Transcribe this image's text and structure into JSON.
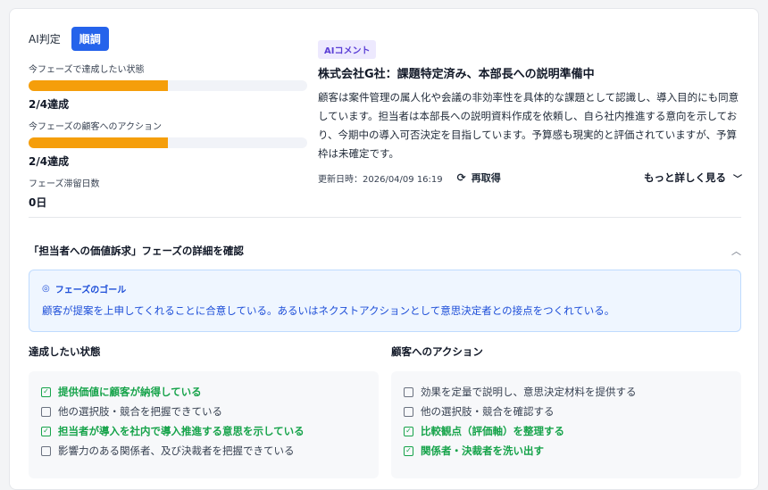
{
  "ai_judgement": {
    "label": "AI判定",
    "badge": "順調",
    "badge_color": "#2563eb"
  },
  "metrics": [
    {
      "title": "今フェーズで達成したい状態",
      "value": "2/4達成",
      "progress": 0.5,
      "bar_color": "#f59e0b"
    },
    {
      "title": "今フェーズの顧客へのアクション",
      "value": "2/4達成",
      "progress": 0.5,
      "bar_color": "#f59e0b"
    },
    {
      "title": "フェーズ滞留日数",
      "value": "0日"
    }
  ],
  "comment": {
    "tag": "AIコメント",
    "title": "株式会社G社：課題特定済み、本部長への説明準備中",
    "body": "顧客は案件管理の属人化や会議の非効率性を具体的な課題として認識し、導入目的にも同意しています。担当者は本部長への説明資料作成を依頼し、自ら社内推進する意向を示しており、今期中の導入可否決定を目指しています。予算感も現実的と評価されていますが、予算枠は未確定です。",
    "updated": "更新日時：2026/04/09 16:19",
    "refetch_label": "再取得",
    "refetch_icon": "refresh-icon",
    "more_label": "もっと詳しく見る",
    "more_icon": "chevron-down-icon"
  },
  "phase": {
    "title": "「担当者への価値訴求」フェーズの詳細を確認",
    "collapse_icon": "chevron-up-icon",
    "goal_title": "フェーズのゴール",
    "goal_icon": "target-icon",
    "goal_text": "顧客が提案を上申してくれることに合意している。あるいはネクストアクションとして意思決定者との接点をつくれている。"
  },
  "states": {
    "title": "達成したい状態",
    "items": [
      {
        "label": "提供価値に顧客が納得している",
        "done": true
      },
      {
        "label": "他の選択肢・競合を把握できている",
        "done": false
      },
      {
        "label": "担当者が導入を社内で導入推進する意思を示している",
        "done": true
      },
      {
        "label": "影響力のある関係者、及び決裁者を把握できている",
        "done": false
      }
    ]
  },
  "actions": {
    "title": "顧客へのアクション",
    "items": [
      {
        "label": "効果を定量で説明し、意思決定材料を提供する",
        "done": false
      },
      {
        "label": "他の選択肢・競合を確認する",
        "done": false
      },
      {
        "label": "比較観点（評価軸）を整理する",
        "done": true
      },
      {
        "label": "関係者・決裁者を洗い出す",
        "done": true
      }
    ]
  },
  "colors": {
    "done": "#16a34a",
    "accent": "#2563eb",
    "goal": "#1d4ed8"
  }
}
